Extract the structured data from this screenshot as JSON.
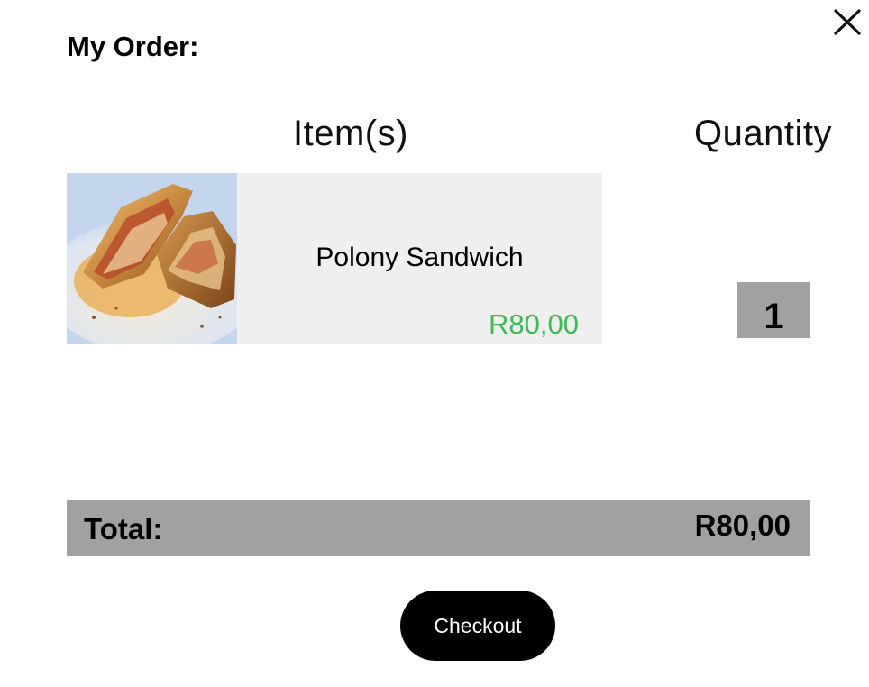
{
  "header": {
    "title": "My Order:",
    "close_icon": "close-icon"
  },
  "columns": {
    "items_label": "Item(s)",
    "quantity_label": "Quantity"
  },
  "order_items": [
    {
      "name": "Polony Sandwich",
      "price": "R80,00",
      "quantity": "1",
      "image_icon": "sandwich-image"
    }
  ],
  "summary": {
    "total_label": "Total:",
    "total_value": "R80,00"
  },
  "actions": {
    "checkout_label": "Checkout"
  },
  "colors": {
    "price_green": "#3fba55",
    "total_bar_gray": "#a2a1a2",
    "card_background": "#efefef",
    "button_black": "#000000"
  }
}
